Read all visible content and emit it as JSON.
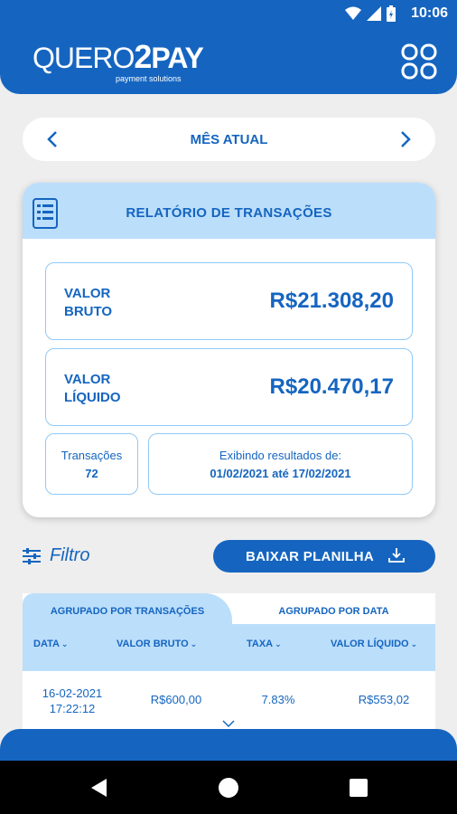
{
  "status_bar": {
    "time": "10:06"
  },
  "header": {
    "logo_prefix": "QUERO",
    "logo_number": "2",
    "logo_suffix": "PAY",
    "logo_tagline": "payment solutions"
  },
  "period": {
    "label": "MÊS ATUAL"
  },
  "report": {
    "title": "RELATÓRIO DE TRANSAÇÕES",
    "gross_label_1": "VALOR",
    "gross_label_2": "BRUTO",
    "gross_value": "R$21.308,20",
    "net_label_1": "VALOR",
    "net_label_2": "LÍQUIDO",
    "net_value": "R$20.470,17",
    "transactions_label": "Transações",
    "transactions_count": "72",
    "results_label": "Exibindo resultados de:",
    "results_range": "01/02/2021 até 17/02/2021"
  },
  "actions": {
    "filter_label": "Filtro",
    "download_label": "BAIXAR PLANILHA"
  },
  "table": {
    "tabs": [
      "AGRUPADO POR TRANSAÇÕES",
      "AGRUPADO POR DATA"
    ],
    "columns": [
      "DATA",
      "VALOR BRUTO",
      "TAXA",
      "VALOR LÍQUIDO"
    ],
    "rows": [
      {
        "date": "16-02-2021",
        "time": "17:22:12",
        "gross": "R$600,00",
        "fee": "7.83%",
        "net": "R$553,02"
      }
    ]
  },
  "colors": {
    "primary": "#1565c0",
    "light": "#bbdefb",
    "border": "#90caf9",
    "background": "#eeeeee"
  }
}
